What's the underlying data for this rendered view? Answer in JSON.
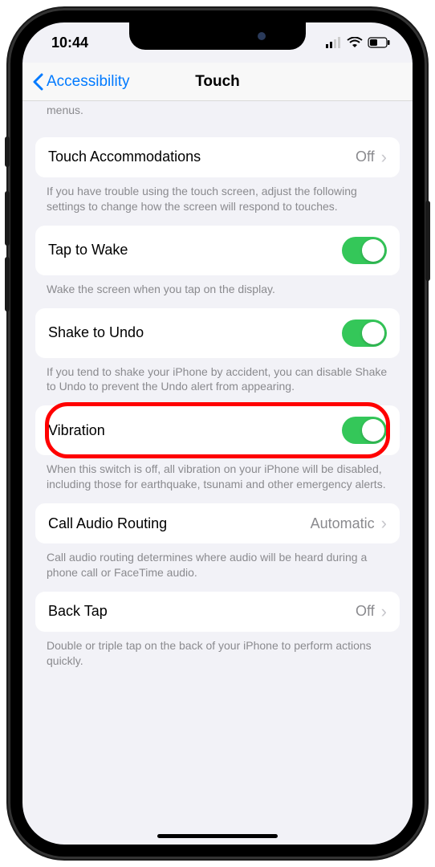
{
  "status": {
    "time": "10:44"
  },
  "nav": {
    "back_label": "Accessibility",
    "title": "Touch"
  },
  "partial_footer_top": "menus.",
  "touch_accommodations": {
    "label": "Touch Accommodations",
    "value": "Off",
    "footer": "If you have trouble using the touch screen, adjust the following settings to change how the screen will respond to touches."
  },
  "tap_to_wake": {
    "label": "Tap to Wake",
    "footer": "Wake the screen when you tap on the display."
  },
  "shake_to_undo": {
    "label": "Shake to Undo",
    "footer": "If you tend to shake your iPhone by accident, you can disable Shake to Undo to prevent the Undo alert from appearing."
  },
  "vibration": {
    "label": "Vibration",
    "footer": "When this switch is off, all vibration on your iPhone will be disabled, including those for earthquake, tsunami and other emergency alerts."
  },
  "call_audio_routing": {
    "label": "Call Audio Routing",
    "value": "Automatic",
    "footer": "Call audio routing determines where audio will be heard during a phone call or FaceTime audio."
  },
  "back_tap": {
    "label": "Back Tap",
    "value": "Off",
    "footer": "Double or triple tap on the back of your iPhone to perform actions quickly."
  }
}
